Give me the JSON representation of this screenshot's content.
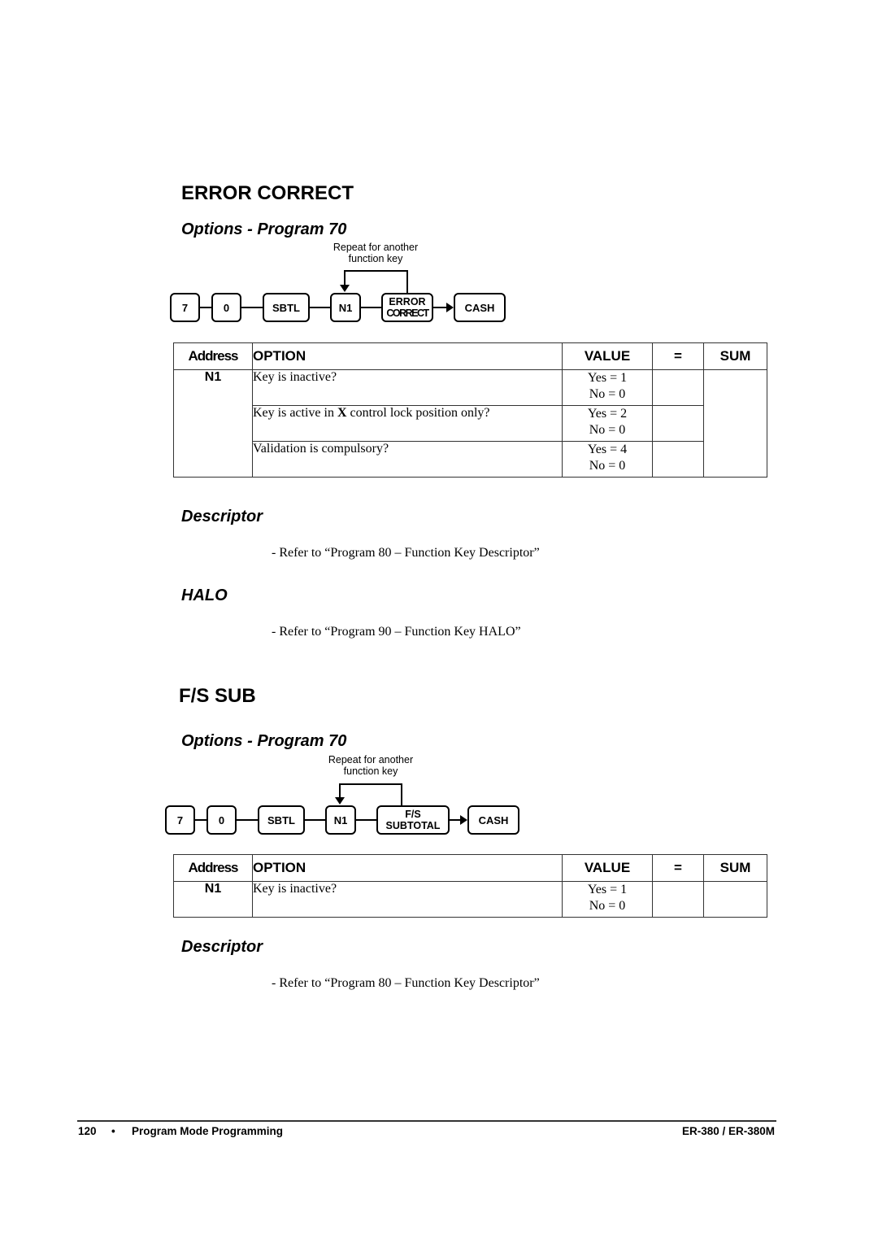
{
  "sections": [
    {
      "title": "ERROR CORRECT",
      "options_heading": "Options - Program 70",
      "diagram": {
        "repeat_note_line1": "Repeat for another",
        "repeat_note_line2": "function key",
        "keys": [
          "7",
          "0",
          "SBTL",
          "N1"
        ],
        "function_key_line1": "ERROR",
        "function_key_line2": "CORRECT",
        "final_key": "CASH"
      },
      "table": {
        "headers": {
          "address": "Address",
          "option": "OPTION",
          "value": "VALUE",
          "equals": "=",
          "sum": "SUM"
        },
        "address": "N1",
        "rows": [
          {
            "option_pre": "Key is inactive?",
            "option_bold": "",
            "option_post": "",
            "yes": "Yes = 1",
            "no": "No = 0"
          },
          {
            "option_pre": "Key is active in ",
            "option_bold": "X",
            "option_post": " control lock position only?",
            "yes": "Yes = 2",
            "no": "No = 0"
          },
          {
            "option_pre": "Validation is compulsory?",
            "option_bold": "",
            "option_post": "",
            "yes": "Yes = 4",
            "no": "No = 0"
          }
        ]
      },
      "descriptor_heading": "Descriptor",
      "descriptor_text": "- Refer to “Program 80 – Function Key Descriptor”",
      "halo_heading": "HALO",
      "halo_text": "- Refer to “Program 90 – Function Key HALO”"
    },
    {
      "title": "F/S SUB",
      "options_heading": "Options - Program 70",
      "diagram": {
        "repeat_note_line1": "Repeat for another",
        "repeat_note_line2": "function key",
        "keys": [
          "7",
          "0",
          "SBTL",
          "N1"
        ],
        "function_key_line1": "F/S",
        "function_key_line2": "SUBTOTAL",
        "final_key": "CASH"
      },
      "table": {
        "headers": {
          "address": "Address",
          "option": "OPTION",
          "value": "VALUE",
          "equals": "=",
          "sum": "SUM"
        },
        "address": "N1",
        "rows": [
          {
            "option_pre": "Key is inactive?",
            "yes": "Yes = 1",
            "no": "No = 0"
          }
        ]
      },
      "descriptor_heading": "Descriptor",
      "descriptor_text": "- Refer to “Program 80 – Function Key Descriptor”"
    }
  ],
  "footer": {
    "page_number": "120",
    "bullet": "•",
    "section": "Program Mode Programming",
    "model": "ER-380 / ER-380M"
  }
}
